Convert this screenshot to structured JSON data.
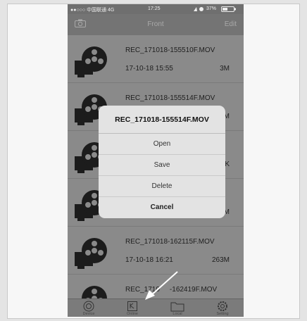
{
  "status_bar": {
    "carrier": "●●○○○ 中国联通 4G",
    "time": "17:25",
    "battery": "37%"
  },
  "nav": {
    "title": "Front",
    "edit_label": "Edit",
    "left_icon": "camera-icon"
  },
  "files": [
    {
      "name": "REC_171018-155510F.MOV",
      "date": "17-10-18 15:55",
      "size": "3M"
    },
    {
      "name": "REC_171018-155514F.MOV",
      "date": "",
      "size": "M"
    },
    {
      "name": "",
      "date": "",
      "size": "12K"
    },
    {
      "name": "",
      "date": "",
      "size": "63M"
    },
    {
      "name": "REC_171018-162115F.MOV",
      "date": "17-10-18 16:21",
      "size": "263M"
    },
    {
      "name": "REC_1710",
      "date": "",
      "size": ""
    },
    {
      "name": "-162419F.MOV",
      "date": "",
      "size": ""
    }
  ],
  "dialog": {
    "title": "REC_171018-155514F.MOV",
    "buttons": [
      "Open",
      "Save",
      "Delete",
      "Cancel"
    ]
  },
  "tabs": [
    {
      "label": "Device",
      "icon": "device-icon"
    },
    {
      "label": "Online",
      "icon": "online-icon"
    },
    {
      "label": "Local",
      "icon": "folder-icon"
    },
    {
      "label": "Setting",
      "icon": "gear-icon"
    }
  ]
}
